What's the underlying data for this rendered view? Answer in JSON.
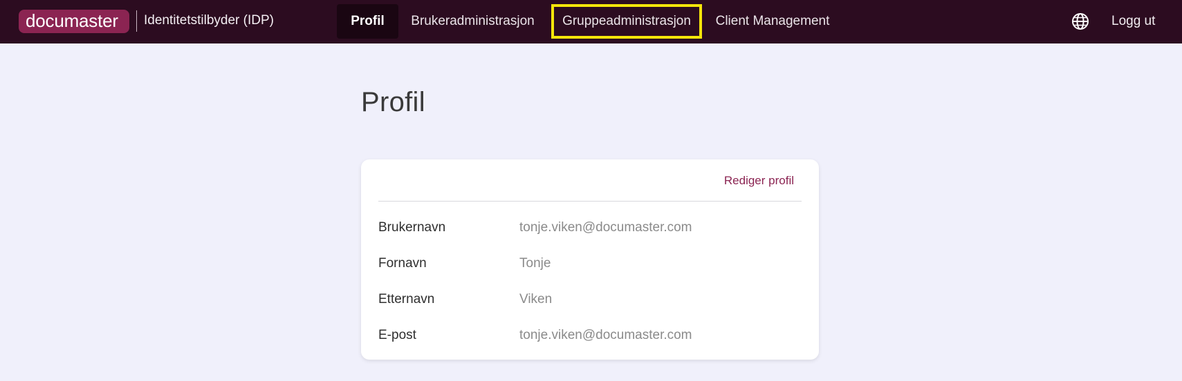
{
  "header": {
    "logo_text": "documaster",
    "app_name": "Identitetstilbyder (IDP)",
    "nav": {
      "profil": "Profil",
      "brukeradministrasjon": "Brukeradministrasjon",
      "gruppeadministrasjon": "Gruppeadministrasjon",
      "client_management": "Client Management"
    },
    "language_icon": "globe-icon",
    "logout_label": "Logg ut"
  },
  "colors": {
    "header_bg": "#2c0c20",
    "brand": "#8b2452",
    "highlight": "#f5e50a",
    "page_bg": "#f0f0fb"
  },
  "main": {
    "title": "Profil",
    "card": {
      "edit_label": "Rediger profil",
      "fields": [
        {
          "label": "Brukernavn",
          "value": "tonje.viken@documaster.com"
        },
        {
          "label": "Fornavn",
          "value": "Tonje"
        },
        {
          "label": "Etternavn",
          "value": "Viken"
        },
        {
          "label": "E-post",
          "value": "tonje.viken@documaster.com"
        }
      ]
    }
  }
}
